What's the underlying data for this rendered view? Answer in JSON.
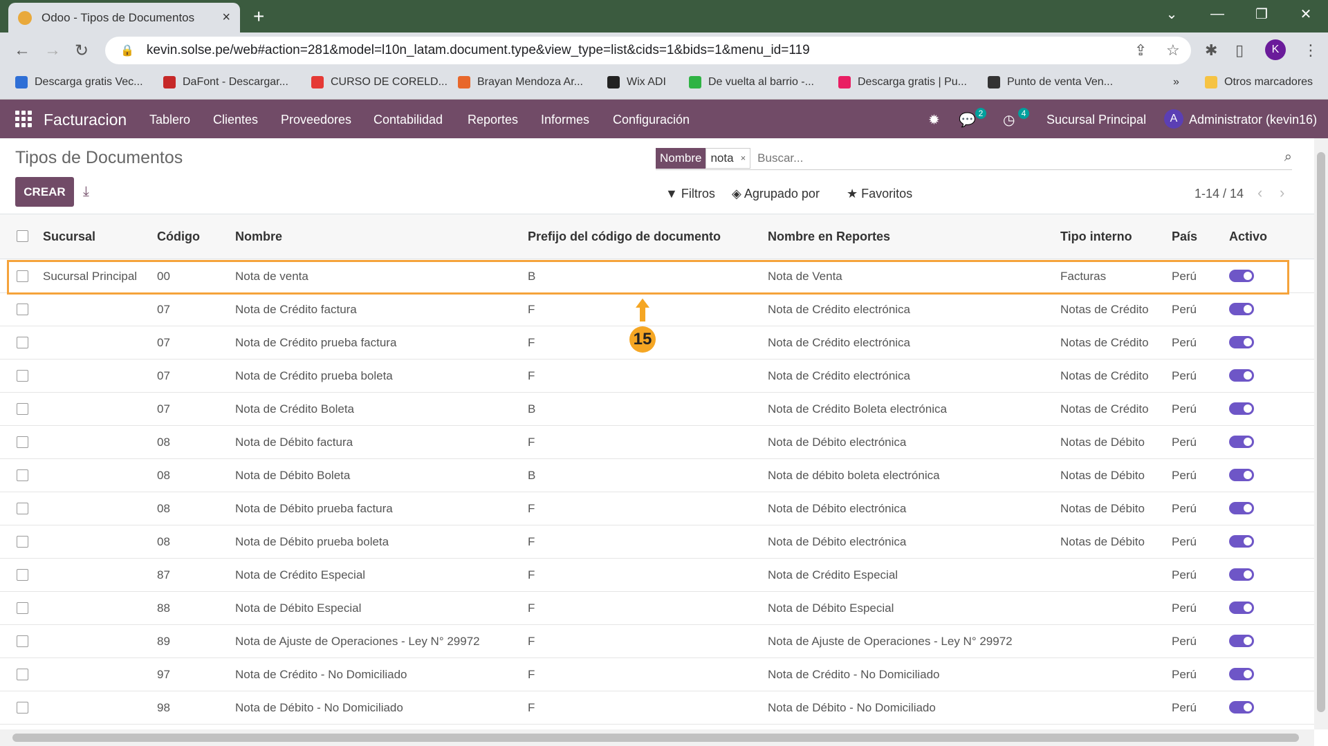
{
  "browser": {
    "tab_title": "Odoo - Tipos de Documentos",
    "tab_close": "×",
    "new_tab": "+",
    "url": "kevin.solse.pe/web#action=281&model=l10n_latam.document.type&view_type=list&cids=1&bids=1&menu_id=119",
    "profile_initial": "K",
    "bookmarks": [
      {
        "label": "Descarga gratis Vec...",
        "color": "#2f6fd6"
      },
      {
        "label": "DaFont - Descargar...",
        "color": "#c62828"
      },
      {
        "label": "CURSO DE CORELD...",
        "color": "#e53935"
      },
      {
        "label": "Brayan Mendoza Ar...",
        "color": "#e8672b"
      },
      {
        "label": "Wix ADI",
        "color": "#222222"
      },
      {
        "label": "De vuelta al barrio -...",
        "color": "#2fb344"
      },
      {
        "label": "Descarga gratis | Pu...",
        "color": "#e91e63"
      },
      {
        "label": "Punto de venta Ven...",
        "color": "#333333"
      }
    ],
    "bookmarks_more": "»",
    "other_bookmarks": "Otros marcadores"
  },
  "navbar": {
    "brand": "Facturacion",
    "menus": [
      "Tablero",
      "Clientes",
      "Proveedores",
      "Contabilidad",
      "Reportes",
      "Informes",
      "Configuración"
    ],
    "messages_count": "2",
    "activities_count": "4",
    "company": "Sucursal Principal",
    "user_initial": "A",
    "user": "Administrator (kevin16)"
  },
  "control_panel": {
    "title": "Tipos de Documentos",
    "create_label": "CREAR",
    "facet_label": "Nombre",
    "facet_value": "nota",
    "facet_remove": "×",
    "search_placeholder": "Buscar...",
    "filters_label": "Filtros",
    "groupby_label": "Agrupado por",
    "favorites_label": "Favoritos",
    "pager": "1-14 / 14"
  },
  "table": {
    "columns": [
      "Sucursal",
      "Código",
      "Nombre",
      "Prefijo del código de documento",
      "Nombre en Reportes",
      "Tipo interno",
      "País",
      "Activo"
    ],
    "rows": [
      {
        "sucursal": "Sucursal Principal",
        "codigo": "00",
        "nombre": "Nota de venta",
        "prefijo": "B",
        "reporte": "Nota de Venta",
        "tipo": "Facturas",
        "pais": "Perú",
        "activo": true
      },
      {
        "sucursal": "",
        "codigo": "07",
        "nombre": "Nota de Crédito factura",
        "prefijo": "F",
        "reporte": "Nota de Crédito electrónica",
        "tipo": "Notas de Crédito",
        "pais": "Perú",
        "activo": true
      },
      {
        "sucursal": "",
        "codigo": "07",
        "nombre": "Nota de Crédito prueba factura",
        "prefijo": "F",
        "reporte": "Nota de Crédito electrónica",
        "tipo": "Notas de Crédito",
        "pais": "Perú",
        "activo": true
      },
      {
        "sucursal": "",
        "codigo": "07",
        "nombre": "Nota de Crédito prueba boleta",
        "prefijo": "F",
        "reporte": "Nota de Crédito electrónica",
        "tipo": "Notas de Crédito",
        "pais": "Perú",
        "activo": true
      },
      {
        "sucursal": "",
        "codigo": "07",
        "nombre": "Nota de Crédito Boleta",
        "prefijo": "B",
        "reporte": "Nota de Crédito Boleta electrónica",
        "tipo": "Notas de Crédito",
        "pais": "Perú",
        "activo": true
      },
      {
        "sucursal": "",
        "codigo": "08",
        "nombre": "Nota de Débito factura",
        "prefijo": "F",
        "reporte": "Nota de Débito electrónica",
        "tipo": "Notas de Débito",
        "pais": "Perú",
        "activo": true
      },
      {
        "sucursal": "",
        "codigo": "08",
        "nombre": "Nota de Débito Boleta",
        "prefijo": "B",
        "reporte": "Nota de débito boleta electrónica",
        "tipo": "Notas de Débito",
        "pais": "Perú",
        "activo": true
      },
      {
        "sucursal": "",
        "codigo": "08",
        "nombre": "Nota de Débito prueba factura",
        "prefijo": "F",
        "reporte": "Nota de Débito electrónica",
        "tipo": "Notas de Débito",
        "pais": "Perú",
        "activo": true
      },
      {
        "sucursal": "",
        "codigo": "08",
        "nombre": "Nota de Débito prueba boleta",
        "prefijo": "F",
        "reporte": "Nota de Débito electrónica",
        "tipo": "Notas de Débito",
        "pais": "Perú",
        "activo": true
      },
      {
        "sucursal": "",
        "codigo": "87",
        "nombre": "Nota de Crédito Especial",
        "prefijo": "F",
        "reporte": "Nota de Crédito Especial",
        "tipo": "",
        "pais": "Perú",
        "activo": true
      },
      {
        "sucursal": "",
        "codigo": "88",
        "nombre": "Nota de Débito Especial",
        "prefijo": "F",
        "reporte": "Nota de Débito Especial",
        "tipo": "",
        "pais": "Perú",
        "activo": true
      },
      {
        "sucursal": "",
        "codigo": "89",
        "nombre": "Nota de Ajuste de Operaciones - Ley N° 29972",
        "prefijo": "F",
        "reporte": "Nota de Ajuste de Operaciones - Ley N° 29972",
        "tipo": "",
        "pais": "Perú",
        "activo": true
      },
      {
        "sucursal": "",
        "codigo": "97",
        "nombre": "Nota de Crédito - No Domiciliado",
        "prefijo": "F",
        "reporte": "Nota de Crédito - No Domiciliado",
        "tipo": "",
        "pais": "Perú",
        "activo": true
      },
      {
        "sucursal": "",
        "codigo": "98",
        "nombre": "Nota de Débito - No Domiciliado",
        "prefijo": "F",
        "reporte": "Nota de Débito - No Domiciliado",
        "tipo": "",
        "pais": "Perú",
        "activo": true
      }
    ]
  },
  "annotation": {
    "step_number": "15",
    "color": "#f5a623"
  },
  "colors": {
    "brand": "#714b67",
    "toggle_on": "#6e56c7",
    "highlight": "#f5a33b"
  }
}
